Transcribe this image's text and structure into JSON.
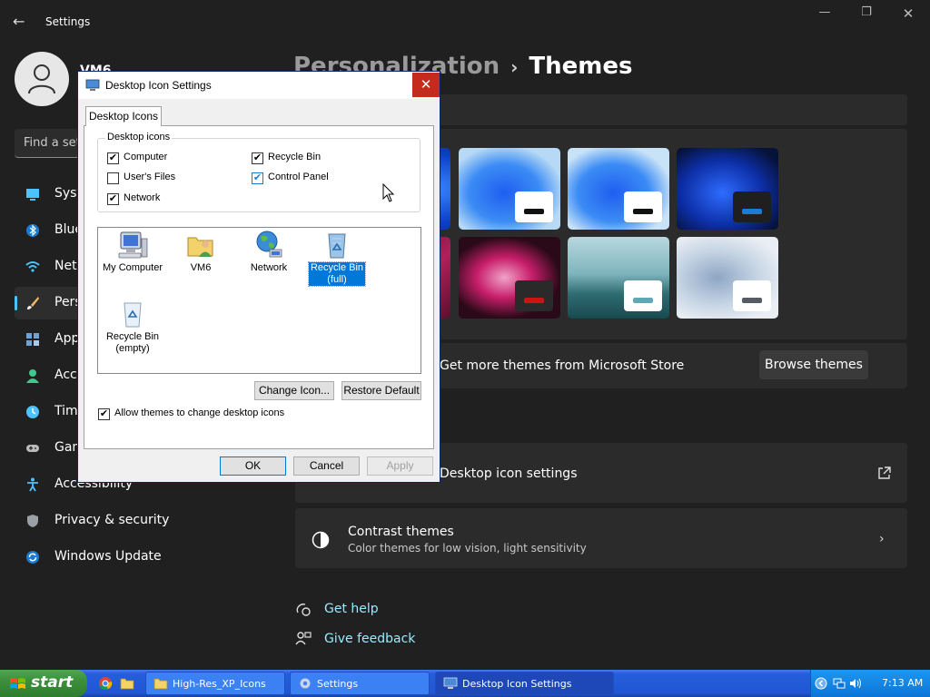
{
  "window": {
    "app_title": "Settings",
    "user_name": "VM6",
    "search_placeholder": "Find a setting",
    "minimize": "—",
    "maximize": "❐",
    "close": "✕",
    "back": "←"
  },
  "breadcrumb": {
    "parent": "Personalization",
    "separator": "›",
    "current": "Themes"
  },
  "sidebar": {
    "items": [
      {
        "label": "System",
        "icon": "display-icon",
        "color": "#4cc2ff"
      },
      {
        "label": "Bluetooth & devices",
        "icon": "bluetooth-icon",
        "color": "#4cc2ff"
      },
      {
        "label": "Network & internet",
        "icon": "wifi-icon",
        "color": "#4cc2ff"
      },
      {
        "label": "Personalization",
        "icon": "brush-icon",
        "color": "#f0b76b",
        "active": true
      },
      {
        "label": "Apps",
        "icon": "apps-icon",
        "color": "#6ea3d8"
      },
      {
        "label": "Accounts",
        "icon": "person-icon",
        "color": "#3ec98e"
      },
      {
        "label": "Time & language",
        "icon": "clock-globe-icon",
        "color": "#4cc2ff"
      },
      {
        "label": "Gaming",
        "icon": "gamepad-icon",
        "color": "#bbbbbb"
      },
      {
        "label": "Accessibility",
        "icon": "accessibility-icon",
        "color": "#4cc2ff"
      },
      {
        "label": "Privacy & security",
        "icon": "shield-icon",
        "color": "#9aa0a6"
      },
      {
        "label": "Windows Update",
        "icon": "update-icon",
        "color": "#4cc2ff"
      }
    ]
  },
  "themes": {
    "badge_colors": [
      "#111111",
      "#111111",
      "#1a7bd1",
      "#cc1414",
      "#5fa9b6",
      "#555c66"
    ]
  },
  "store": {
    "text": "Get more themes from Microsoft Store",
    "browse_label": "Browse themes"
  },
  "related": {
    "desktop_icon_settings": "Desktop icon settings",
    "contrast_title": "Contrast themes",
    "contrast_subtitle": "Color themes for low vision, light sensitivity"
  },
  "help": {
    "get_help": "Get help",
    "give_feedback": "Give feedback"
  },
  "dialog": {
    "title": "Desktop Icon Settings",
    "close": "✕",
    "tab": "Desktop Icons",
    "group_label": "Desktop icons",
    "checks": {
      "computer": "Computer",
      "recycle_bin": "Recycle Bin",
      "users_files": "User's Files",
      "control_panel": "Control Panel",
      "network": "Network"
    },
    "check_mark": "✔",
    "icons": {
      "my_computer": "My Computer",
      "vm6": "VM6",
      "network": "Network",
      "recycle_full_1": "Recycle Bin",
      "recycle_full_2": "(full)",
      "recycle_empty_1": "Recycle Bin",
      "recycle_empty_2": "(empty)"
    },
    "change_icon": "Change Icon...",
    "restore_default": "Restore Default",
    "allow_themes": "Allow themes to change desktop icons",
    "ok": "OK",
    "cancel": "Cancel",
    "apply": "Apply"
  },
  "taskbar": {
    "start": "start",
    "buttons": [
      "High-Res_XP_Icons",
      "Settings",
      "Desktop Icon Settings"
    ],
    "clock": "7:13 AM"
  }
}
